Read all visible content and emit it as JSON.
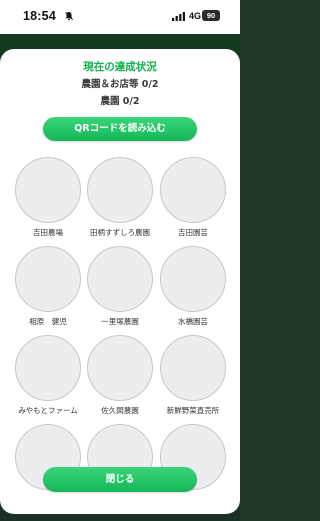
{
  "status_bar": {
    "time": "18:54",
    "network": "4G",
    "battery": "90",
    "icons": [
      "bell-muted-icon",
      "signal-icon"
    ]
  },
  "modal": {
    "title": "現在の達成状況",
    "shops_progress": "農園＆お店等 0/2",
    "farms_progress": "農園 0/2",
    "qr_button_label": "QRコードを読み込む",
    "close_button_label": "閉じる",
    "farms": [
      {
        "name": "吉田農場"
      },
      {
        "name": "田柄すずしろ農園"
      },
      {
        "name": "吉田園芸"
      },
      {
        "name": "相原　健児"
      },
      {
        "name": "一里塚農園"
      },
      {
        "name": "水橋園芸"
      },
      {
        "name": "みやもとファーム"
      },
      {
        "name": "佐久間農園"
      },
      {
        "name": "新鮮野菜直売所"
      },
      {
        "name": ""
      },
      {
        "name": ""
      },
      {
        "name": ""
      }
    ]
  },
  "colors": {
    "accent_green": "#12b24a",
    "button_green": "#1fc463",
    "placeholder_gray": "#ededed"
  }
}
